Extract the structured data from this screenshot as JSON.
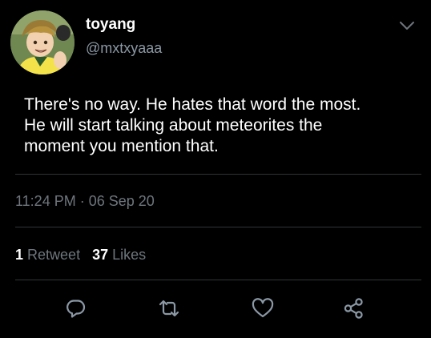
{
  "user": {
    "display_name": "toyang",
    "handle": "@mxtxyaaa"
  },
  "tweet": {
    "text_lines": [
      "There's no way. He hates that word the most.",
      "He will start talking about meteorites the",
      "moment you mention that."
    ],
    "timestamp": "11:24 PM · 06 Sep 20"
  },
  "stats": {
    "retweets_count": "1",
    "retweets_label": "Retweet",
    "likes_count": "37",
    "likes_label": "Likes"
  },
  "icons": {
    "menu": "chevron-down-icon",
    "reply": "reply-icon",
    "retweet": "retweet-icon",
    "like": "heart-icon",
    "share": "share-icon"
  },
  "colors": {
    "background": "#000000",
    "primary_text": "#ffffff",
    "secondary_text": "#6e767d",
    "icon": "#8b98a5",
    "divider": "#2f3336"
  }
}
